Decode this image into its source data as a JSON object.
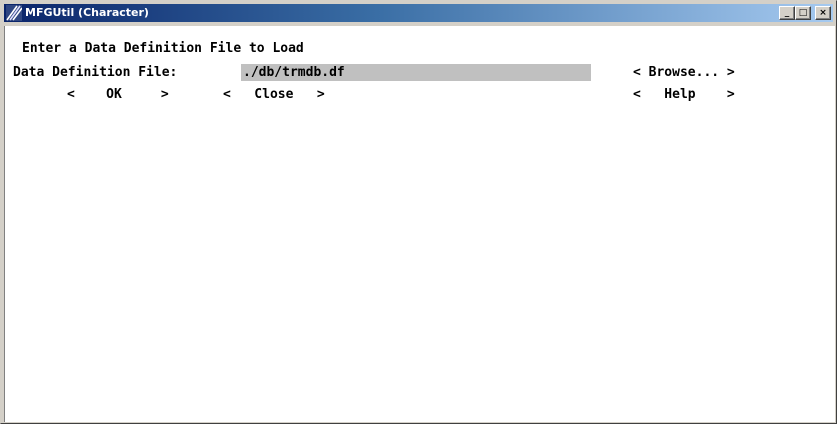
{
  "window": {
    "title": "MFGUtil (Character)",
    "controls": {
      "minimize": "_",
      "maximize": "□",
      "close": "×"
    }
  },
  "form": {
    "heading": "Enter a Data Definition File to Load",
    "field_label": "Data Definition File:",
    "field_value": "./db/trmdb.df"
  },
  "buttons": {
    "browse": "< Browse... >",
    "ok": "<    OK     >",
    "close": "<   Close   >",
    "help": "<   Help    >"
  },
  "colors": {
    "titlebar_start": "#0a246a",
    "titlebar_end": "#a6caf0",
    "field_background": "#c0c0c0",
    "client_background": "#ffffff"
  }
}
